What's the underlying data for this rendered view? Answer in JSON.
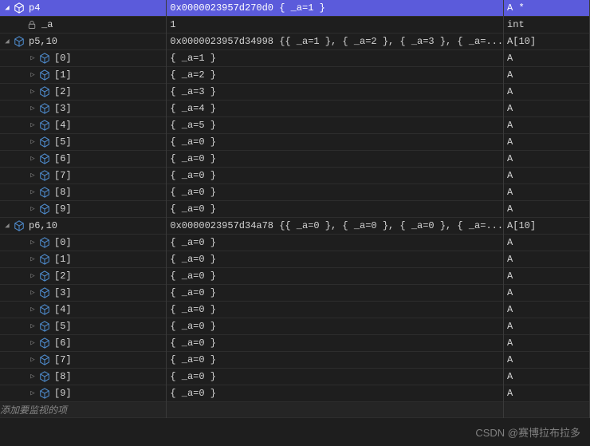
{
  "rows": [
    {
      "indent": 0,
      "arrow": "down",
      "icon": "cube",
      "name": "p4",
      "value": "0x0000023957d270d0 { _a=1 }",
      "type": "A *",
      "selected": true
    },
    {
      "indent": 1,
      "arrow": "none",
      "icon": "lock",
      "name": "_a",
      "value": "1",
      "type": "int"
    },
    {
      "indent": 0,
      "arrow": "down",
      "icon": "cube",
      "name": "p5,10",
      "value": "0x0000023957d34998 {{ _a=1 }, { _a=2 }, { _a=3 }, { _a=...",
      "type": "A[10]"
    },
    {
      "indent": 2,
      "arrow": "right",
      "icon": "cube",
      "name": "[0]",
      "value": "{ _a=1 }",
      "type": "A"
    },
    {
      "indent": 2,
      "arrow": "right",
      "icon": "cube",
      "name": "[1]",
      "value": "{ _a=2 }",
      "type": "A"
    },
    {
      "indent": 2,
      "arrow": "right",
      "icon": "cube",
      "name": "[2]",
      "value": "{ _a=3 }",
      "type": "A"
    },
    {
      "indent": 2,
      "arrow": "right",
      "icon": "cube",
      "name": "[3]",
      "value": "{ _a=4 }",
      "type": "A"
    },
    {
      "indent": 2,
      "arrow": "right",
      "icon": "cube",
      "name": "[4]",
      "value": "{ _a=5 }",
      "type": "A"
    },
    {
      "indent": 2,
      "arrow": "right",
      "icon": "cube",
      "name": "[5]",
      "value": "{ _a=0 }",
      "type": "A"
    },
    {
      "indent": 2,
      "arrow": "right",
      "icon": "cube",
      "name": "[6]",
      "value": "{ _a=0 }",
      "type": "A"
    },
    {
      "indent": 2,
      "arrow": "right",
      "icon": "cube",
      "name": "[7]",
      "value": "{ _a=0 }",
      "type": "A"
    },
    {
      "indent": 2,
      "arrow": "right",
      "icon": "cube",
      "name": "[8]",
      "value": "{ _a=0 }",
      "type": "A"
    },
    {
      "indent": 2,
      "arrow": "right",
      "icon": "cube",
      "name": "[9]",
      "value": "{ _a=0 }",
      "type": "A"
    },
    {
      "indent": 0,
      "arrow": "down",
      "icon": "cube",
      "name": "p6,10",
      "value": "0x0000023957d34a78 {{ _a=0 }, { _a=0 }, { _a=0 }, { _a=...",
      "type": "A[10]"
    },
    {
      "indent": 2,
      "arrow": "right",
      "icon": "cube",
      "name": "[0]",
      "value": "{ _a=0 }",
      "type": "A"
    },
    {
      "indent": 2,
      "arrow": "right",
      "icon": "cube",
      "name": "[1]",
      "value": "{ _a=0 }",
      "type": "A"
    },
    {
      "indent": 2,
      "arrow": "right",
      "icon": "cube",
      "name": "[2]",
      "value": "{ _a=0 }",
      "type": "A"
    },
    {
      "indent": 2,
      "arrow": "right",
      "icon": "cube",
      "name": "[3]",
      "value": "{ _a=0 }",
      "type": "A"
    },
    {
      "indent": 2,
      "arrow": "right",
      "icon": "cube",
      "name": "[4]",
      "value": "{ _a=0 }",
      "type": "A"
    },
    {
      "indent": 2,
      "arrow": "right",
      "icon": "cube",
      "name": "[5]",
      "value": "{ _a=0 }",
      "type": "A"
    },
    {
      "indent": 2,
      "arrow": "right",
      "icon": "cube",
      "name": "[6]",
      "value": "{ _a=0 }",
      "type": "A"
    },
    {
      "indent": 2,
      "arrow": "right",
      "icon": "cube",
      "name": "[7]",
      "value": "{ _a=0 }",
      "type": "A"
    },
    {
      "indent": 2,
      "arrow": "right",
      "icon": "cube",
      "name": "[8]",
      "value": "{ _a=0 }",
      "type": "A"
    },
    {
      "indent": 2,
      "arrow": "right",
      "icon": "cube",
      "name": "[9]",
      "value": "{ _a=0 }",
      "type": "A"
    }
  ],
  "addItemText": "添加要监视的项",
  "watermark": "CSDN @赛博拉布拉多",
  "icons": {
    "cube_color": "#4e8acb",
    "lock_glyph": "🔒"
  }
}
